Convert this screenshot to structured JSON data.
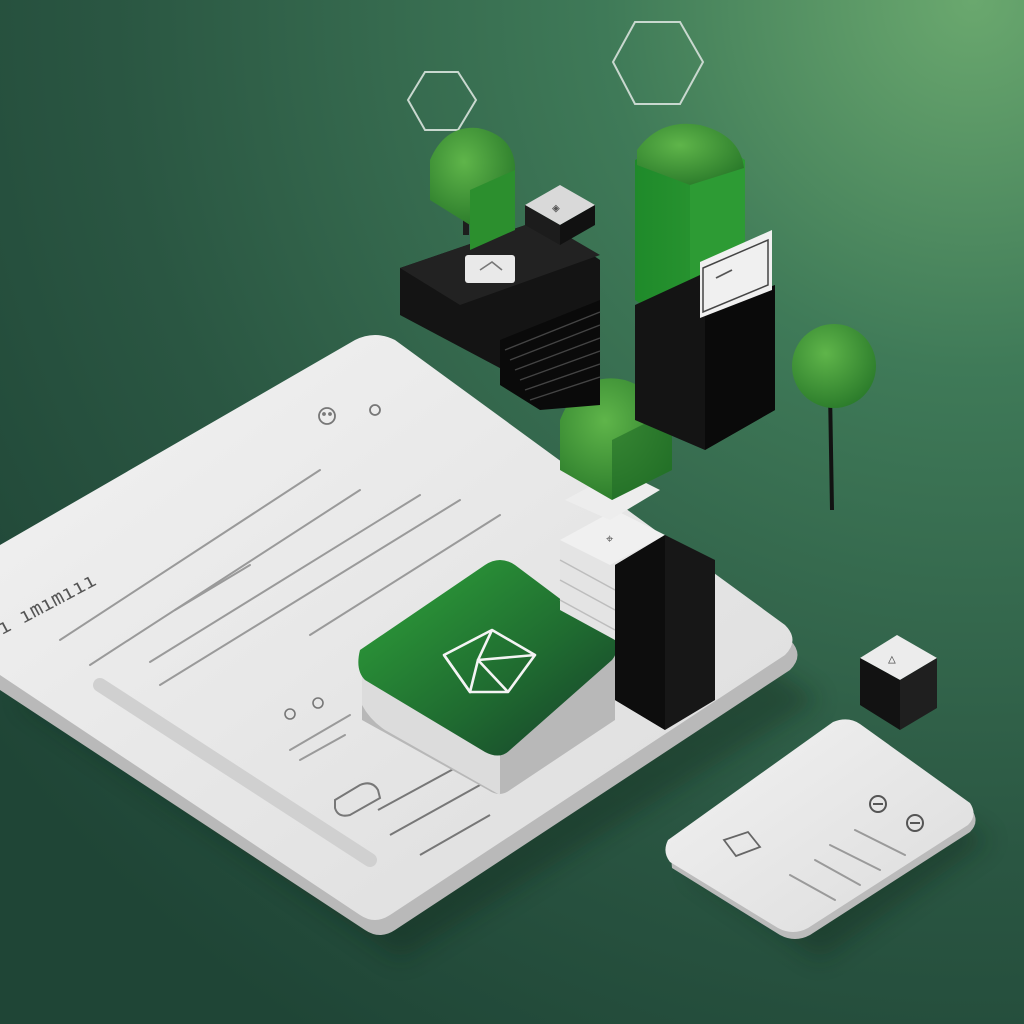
{
  "scene": {
    "description_colors": {
      "background_dark": "#234a3a",
      "background_light": "#6aa86e",
      "accent_green": "#2f8f3a",
      "block_black": "#151515",
      "panel_white": "#ececec"
    },
    "main_panel": {
      "side_label": "ı ımımııı",
      "icons": [
        "face-icon",
        "circle-icon"
      ],
      "lower_icons": [
        "small-circle-icon",
        "small-circle-icon"
      ]
    },
    "green_tile": {
      "icon": "geometric-shape-icon"
    },
    "small_panel": {
      "icons": [
        "circle-icon",
        "circle-icon",
        "square-icon"
      ]
    },
    "hexagons": 2,
    "trees": 4
  }
}
